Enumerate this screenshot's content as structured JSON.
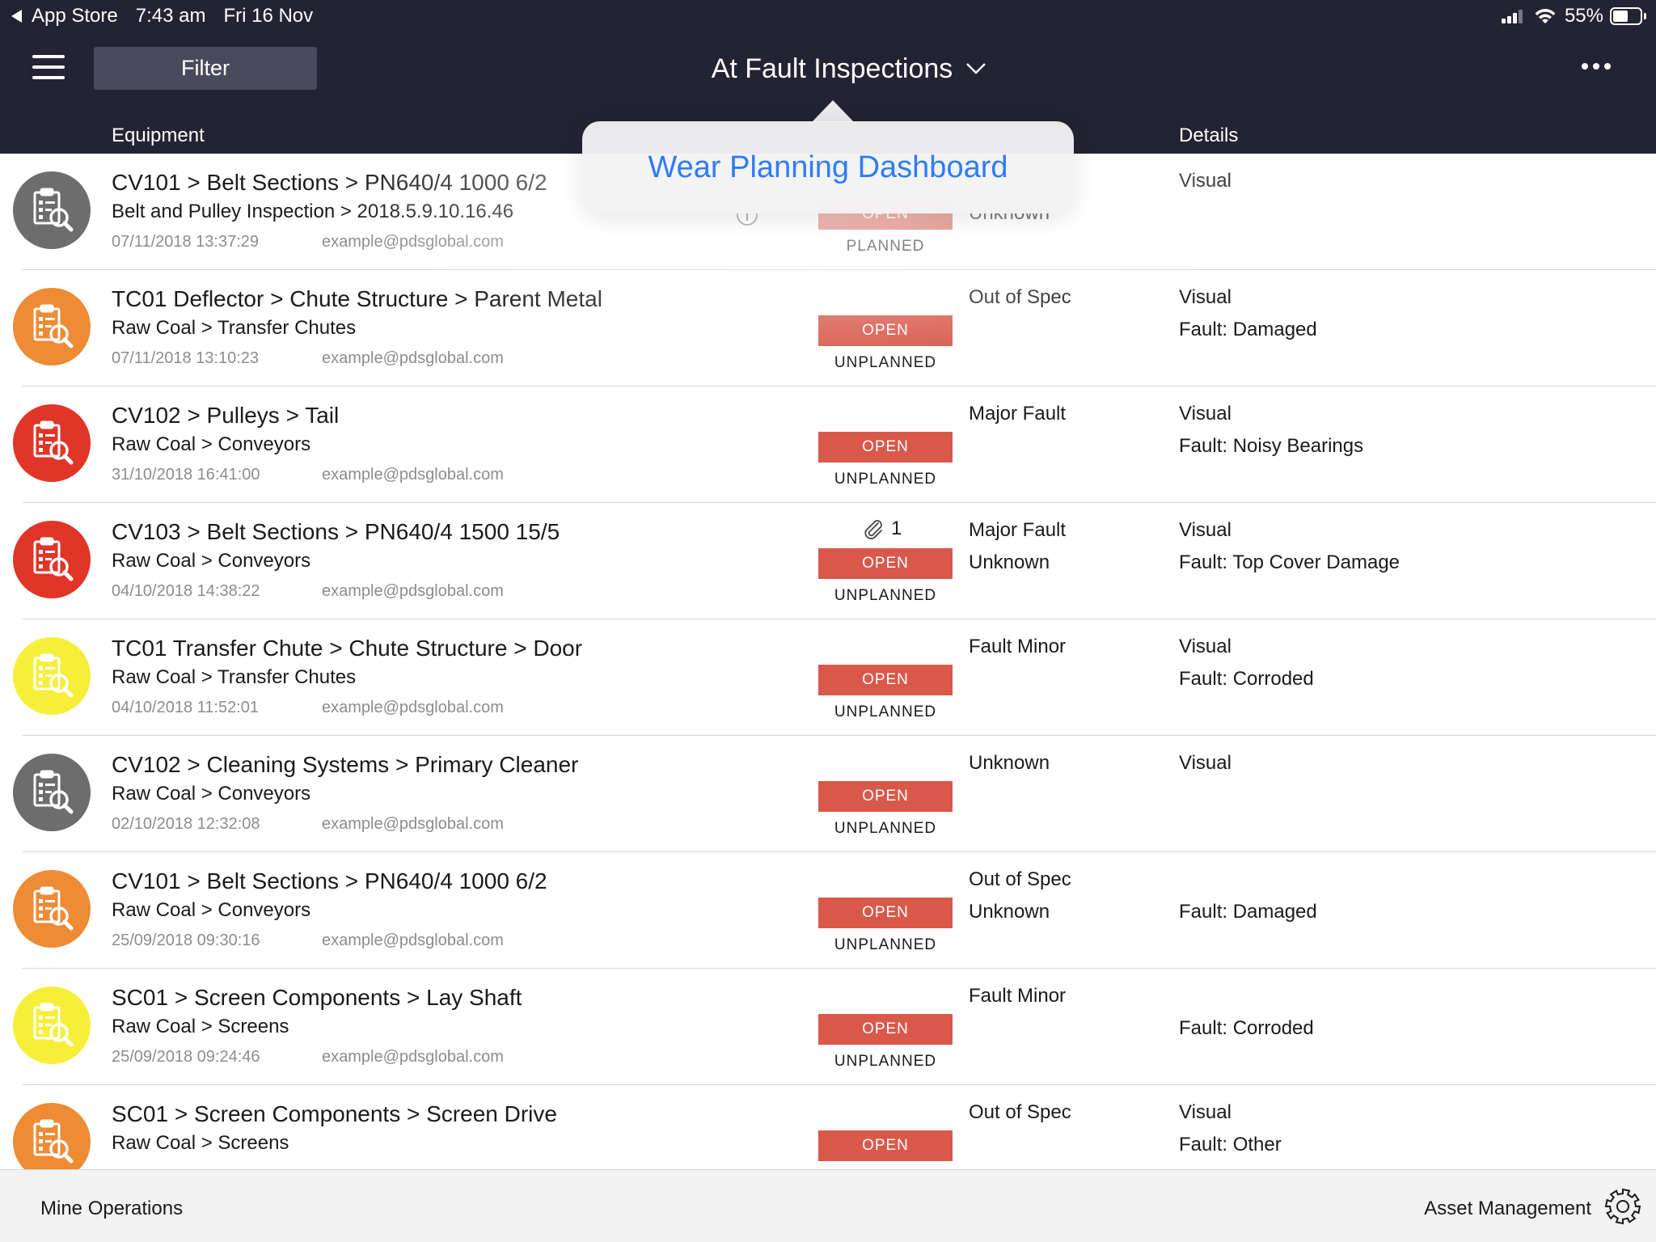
{
  "status_bar": {
    "back_app": "App Store",
    "time": "7:43 am",
    "date": "Fri 16 Nov",
    "battery": "55%"
  },
  "header": {
    "menu_icon": "hamburger-icon",
    "filter_label": "Filter",
    "title": "At Fault Inspections",
    "title_icon": "chevron-down-icon",
    "more_icon": "ellipsis-icon",
    "columns": {
      "equipment": "Equipment",
      "details": "Details"
    }
  },
  "popover": {
    "items": [
      "Wear Planning Dashboard"
    ]
  },
  "colors": {
    "header_bg": "#242333",
    "open_badge": "#d8594a",
    "grey": "#6d6d6d",
    "orange": "#ef8a35",
    "red": "#e13527",
    "yellow": "#f6ef3a",
    "link_blue": "#2f7cf6"
  },
  "rows": [
    {
      "icon_color": "grey",
      "title": "CV101 > Belt Sections > PN640/4 1000 6/2",
      "subtitle": "Belt and Pulley Inspection > 2018.5.9.10.16.46",
      "timestamp": "07/11/2018 13:37:29",
      "email": "example@pdsglobal.com",
      "badge": "OPEN",
      "plan": "PLANNED",
      "status1": "",
      "status2": "Unknown",
      "detail1": "Visual",
      "detail2": "",
      "attachments": ""
    },
    {
      "icon_color": "orange",
      "title": "TC01 Deflector > Chute Structure > Parent Metal",
      "subtitle": "Raw Coal > Transfer Chutes",
      "timestamp": "07/11/2018 13:10:23",
      "email": "example@pdsglobal.com",
      "badge": "OPEN",
      "plan": "UNPLANNED",
      "status1": "Out of Spec",
      "status2": "",
      "detail1": "Visual",
      "detail2": "Fault: Damaged",
      "attachments": ""
    },
    {
      "icon_color": "red",
      "title": "CV102 > Pulleys > Tail",
      "subtitle": "Raw Coal > Conveyors",
      "timestamp": "31/10/2018 16:41:00",
      "email": "example@pdsglobal.com",
      "badge": "OPEN",
      "plan": "UNPLANNED",
      "status1": "Major Fault",
      "status2": "",
      "detail1": "Visual",
      "detail2": "Fault: Noisy Bearings",
      "attachments": ""
    },
    {
      "icon_color": "red",
      "title": "CV103 > Belt Sections > PN640/4 1500 15/5",
      "subtitle": "Raw Coal > Conveyors",
      "timestamp": "04/10/2018 14:38:22",
      "email": "example@pdsglobal.com",
      "badge": "OPEN",
      "plan": "UNPLANNED",
      "status1": "Major Fault",
      "status2": "Unknown",
      "detail1": "Visual",
      "detail2": "Fault: Top Cover Damage",
      "attachments": "1"
    },
    {
      "icon_color": "yellow",
      "title": "TC01 Transfer Chute > Chute Structure > Door",
      "subtitle": "Raw Coal > Transfer Chutes",
      "timestamp": "04/10/2018 11:52:01",
      "email": "example@pdsglobal.com",
      "badge": "OPEN",
      "plan": "UNPLANNED",
      "status1": "Fault Minor",
      "status2": "",
      "detail1": "Visual",
      "detail2": "Fault: Corroded",
      "attachments": ""
    },
    {
      "icon_color": "grey",
      "title": "CV102 > Cleaning Systems > Primary Cleaner",
      "subtitle": "Raw Coal > Conveyors",
      "timestamp": "02/10/2018 12:32:08",
      "email": "example@pdsglobal.com",
      "badge": "OPEN",
      "plan": "UNPLANNED",
      "status1": "Unknown",
      "status2": "",
      "detail1": "Visual",
      "detail2": "",
      "attachments": ""
    },
    {
      "icon_color": "orange",
      "title": "CV101 > Belt Sections > PN640/4 1000 6/2",
      "subtitle": "Raw Coal > Conveyors",
      "timestamp": "25/09/2018 09:30:16",
      "email": "example@pdsglobal.com",
      "badge": "OPEN",
      "plan": "UNPLANNED",
      "status1": "Out of Spec",
      "status2": "Unknown",
      "detail1": "",
      "detail2": "Fault: Damaged",
      "attachments": ""
    },
    {
      "icon_color": "yellow",
      "title": "SC01 > Screen Components > Lay Shaft",
      "subtitle": "Raw Coal > Screens",
      "timestamp": "25/09/2018 09:24:46",
      "email": "example@pdsglobal.com",
      "badge": "OPEN",
      "plan": "UNPLANNED",
      "status1": "Fault Minor",
      "status2": "",
      "detail1": "",
      "detail2": "Fault: Corroded",
      "attachments": ""
    },
    {
      "icon_color": "orange",
      "title": "SC01 > Screen Components > Screen Drive",
      "subtitle": "Raw Coal > Screens",
      "timestamp": "",
      "email": "",
      "badge": "OPEN",
      "plan": "",
      "status1": "Out of Spec",
      "status2": "",
      "detail1": "Visual",
      "detail2": "Fault: Other",
      "attachments": ""
    }
  ],
  "footer": {
    "left_label": "Mine Operations",
    "right_label": "Asset Management",
    "right_icon": "gear-icon"
  }
}
